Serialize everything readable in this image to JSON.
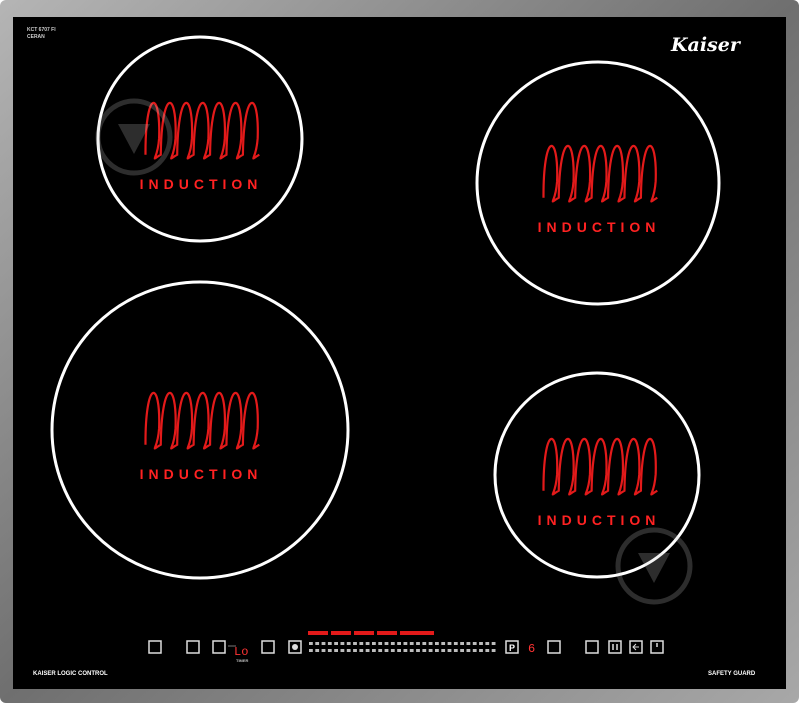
{
  "brand": "Kaiser",
  "model_line1": "KCT 6707 FI",
  "model_line2": "CERAN",
  "zone_label": "INDUCTION",
  "left_caption": "KAISER LOGIC CONTROL",
  "right_caption": "SAFETY GUARD",
  "control_panel": {
    "timer_readout": "Lo",
    "timer_caption": "TIMER",
    "boost_label": "P",
    "level_indicator": "6"
  },
  "colors": {
    "glass": "#000000",
    "frame": "#8c8c8c",
    "zone_ring": "#ffffff",
    "coil": "#e31a1a",
    "label": "#ff2222"
  },
  "zones": [
    {
      "name": "zone-rear-left"
    },
    {
      "name": "zone-rear-right"
    },
    {
      "name": "zone-front-left"
    },
    {
      "name": "zone-front-right"
    }
  ]
}
